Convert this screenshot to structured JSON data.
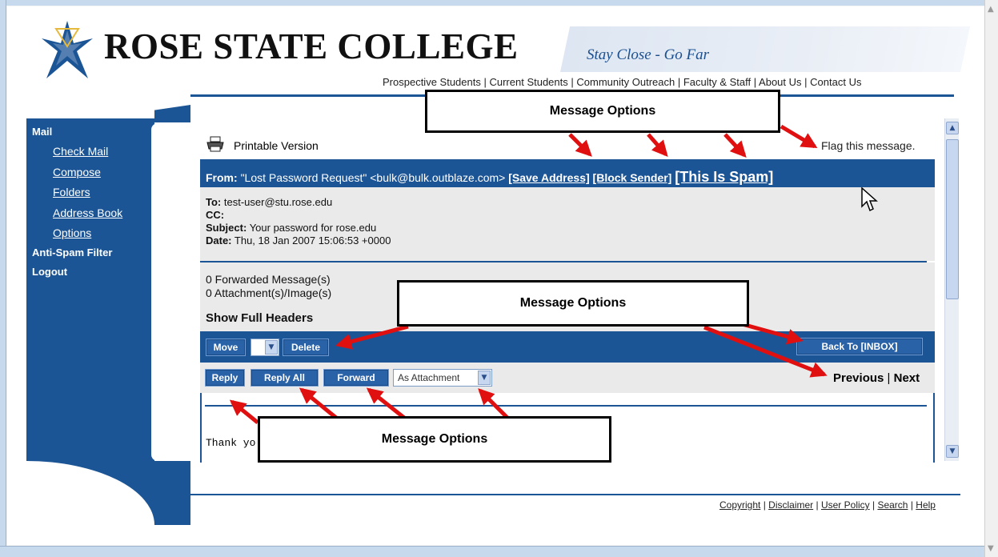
{
  "header": {
    "college_name": "ROSE STATE COLLEGE",
    "tagline": "Stay Close - Go Far",
    "nav": [
      "Prospective Students",
      "Current Students",
      "Community Outreach",
      "Faculty & Staff",
      "About Us",
      "Contact Us"
    ]
  },
  "sidebar": {
    "mail": "Mail",
    "items": [
      "Check Mail",
      "Compose",
      "Folders",
      "Address Book",
      "Options"
    ],
    "anti_spam": "Anti-Spam Filter",
    "logout": "Logout"
  },
  "message": {
    "printable": "Printable Version",
    "flag": "Flag this message.",
    "from_label": "From:",
    "from_value": "\"Lost Password Request\" <bulk@bulk.outblaze.com>",
    "save_address": "[Save Address]",
    "block_sender": "[Block Sender]",
    "this_is_spam": "[This Is Spam]",
    "to_label": "To:",
    "to_value": "test-user@stu.rose.edu",
    "cc_label": "CC:",
    "subject_label": "Subject:",
    "subject_value": "Your password for rose.edu",
    "date_label": "Date:",
    "date_value": "Thu, 18 Jan 2007 15:06:53 +0000",
    "forwarded": "0 Forwarded Message(s)",
    "attachments": "0 Attachment(s)/Image(s)",
    "show_headers": "Show Full Headers",
    "body_preview": "Thank yo"
  },
  "toolbar": {
    "move": "Move",
    "delete": "Delete",
    "back_inbox": "Back To [INBOX]",
    "reply": "Reply",
    "reply_all": "Reply All",
    "forward": "Forward",
    "forward_mode": "As Attachment",
    "previous": "Previous",
    "separator": "|",
    "next": "Next"
  },
  "footer": {
    "links": [
      "Copyright",
      "Disclaimer",
      "User Policy",
      "Search",
      "Help"
    ]
  },
  "annotations": {
    "callout_top": "Message Options",
    "callout_middle": "Message Options",
    "callout_bottom": "Message Options"
  },
  "colors": {
    "brand_blue": "#1c5596",
    "panel_gray": "#eaeaea",
    "arrow_red": "#e01010"
  }
}
